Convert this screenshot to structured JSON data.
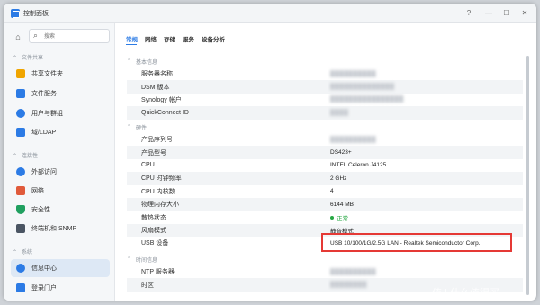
{
  "window": {
    "title": "控制面板",
    "help_icon": "?",
    "minimize_icon": "—",
    "maximize_icon": "☐",
    "close_icon": "✕"
  },
  "sidebar": {
    "search_placeholder": "搜索",
    "sections": [
      {
        "label": "文件共享",
        "items": [
          {
            "label": "共享文件夹",
            "icon": "folder-icon",
            "color": "#f0a500"
          },
          {
            "label": "文件服务",
            "icon": "file-service-icon",
            "color": "#2c7be5"
          },
          {
            "label": "用户与群组",
            "icon": "user-group-icon",
            "color": "#2c7be5"
          },
          {
            "label": "域/LDAP",
            "icon": "domain-icon",
            "color": "#2c7be5"
          }
        ]
      },
      {
        "label": "连接性",
        "items": [
          {
            "label": "外部访问",
            "icon": "globe-icon",
            "color": "#2c7be5"
          },
          {
            "label": "网络",
            "icon": "home-network-icon",
            "color": "#e05a3b"
          },
          {
            "label": "安全性",
            "icon": "shield-icon",
            "color": "#20a060"
          },
          {
            "label": "终端机和 SNMP",
            "icon": "terminal-icon",
            "color": "#4a5563"
          }
        ]
      },
      {
        "label": "系统",
        "items": [
          {
            "label": "信息中心",
            "icon": "info-icon",
            "color": "#2c7be5",
            "active": true
          },
          {
            "label": "登录门户",
            "icon": "portal-icon",
            "color": "#2c7be5"
          }
        ]
      }
    ]
  },
  "tabs": [
    {
      "label": "常规",
      "active": true
    },
    {
      "label": "网络"
    },
    {
      "label": "存储"
    },
    {
      "label": "服务"
    },
    {
      "label": "设备分析"
    }
  ],
  "groups": {
    "basic": {
      "label": "基本信息",
      "rows": [
        {
          "key": "服务器名称",
          "value": "██████████"
        },
        {
          "key": "DSM 版本",
          "value": "██████████████"
        },
        {
          "key": "Synology 帐户",
          "value": "████████████████"
        },
        {
          "key": "QuickConnect ID",
          "value": "████"
        }
      ]
    },
    "hardware": {
      "label": "硬件",
      "rows": [
        {
          "key": "产品序列号",
          "value": "██████████"
        },
        {
          "key": "产品型号",
          "value": "DS423+"
        },
        {
          "key": "CPU",
          "value": "INTEL Celeron J4125"
        },
        {
          "key": "CPU 时钟频率",
          "value": "2 GHz"
        },
        {
          "key": "CPU 内核数",
          "value": "4"
        },
        {
          "key": "物理内存大小",
          "value": "6144 MB"
        },
        {
          "key": "散热状态",
          "value": "正常",
          "status_color": "#27a844"
        },
        {
          "key": "风扇模式",
          "value": "静音模式"
        },
        {
          "key": "USB 设备",
          "value": "USB 10/100/1G/2.5G LAN - Realtek Semiconductor Corp."
        }
      ]
    },
    "time": {
      "label": "时间信息",
      "rows": [
        {
          "key": "NTP 服务器",
          "value": "██████████"
        },
        {
          "key": "时区",
          "value": "████████"
        }
      ]
    }
  },
  "watermark": "值 | 什么值得买"
}
